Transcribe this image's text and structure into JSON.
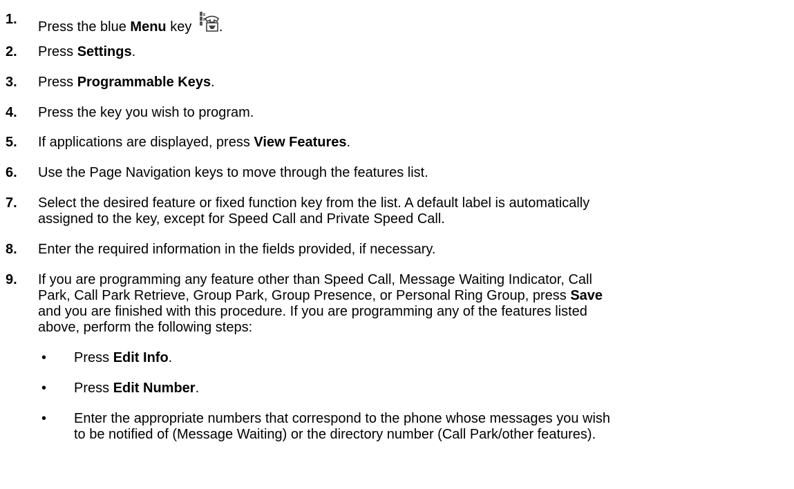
{
  "steps": [
    {
      "num": "1.",
      "pre": "Press the blue ",
      "bold": "Menu",
      "post": " key ",
      "icon": "menu-key-phone-icon",
      "tail": "."
    },
    {
      "num": "2.",
      "pre": "Press ",
      "bold": "Settings",
      "post": "."
    },
    {
      "num": "3.",
      "pre": "Press ",
      "bold": "Programmable Keys",
      "post": "."
    },
    {
      "num": "4.",
      "text": "Press the key you wish to program."
    },
    {
      "num": "5.",
      "pre": "If applications are displayed, press ",
      "bold": "View Features",
      "post": "."
    },
    {
      "num": "6.",
      "text": "Use the Page Navigation keys to move through the features list."
    },
    {
      "num": "7.",
      "line1": "Select the desired feature or fixed function key from the list. A default label is automatically",
      "line2": "assigned to the key, except for Speed Call and Private Speed Call."
    },
    {
      "num": "8.",
      "text": "Enter the required information in the fields provided, if necessary."
    },
    {
      "num": "9.",
      "line1": "If you are programming any feature other than Speed Call, Message Waiting Indicator, Call",
      "line2_pre": "Park, Call Park Retrieve, Group Park, Group Presence, or Personal Ring Group, press ",
      "line2_bold": "Save",
      "line3": "and you are finished with this procedure. If you are programming any of the features listed",
      "line4": "above, perform the following steps:"
    }
  ],
  "bullets": [
    {
      "dot": "•",
      "pre": "Press ",
      "bold": "Edit Info",
      "post": "."
    },
    {
      "dot": "•",
      "pre": "Press ",
      "bold": "Edit Number",
      "post": "."
    },
    {
      "dot": "•",
      "line1": "Enter the appropriate numbers that correspond to the phone whose messages you wish",
      "line2": "to be notified of (Message Waiting) or the directory number (Call Park/other features)."
    }
  ]
}
